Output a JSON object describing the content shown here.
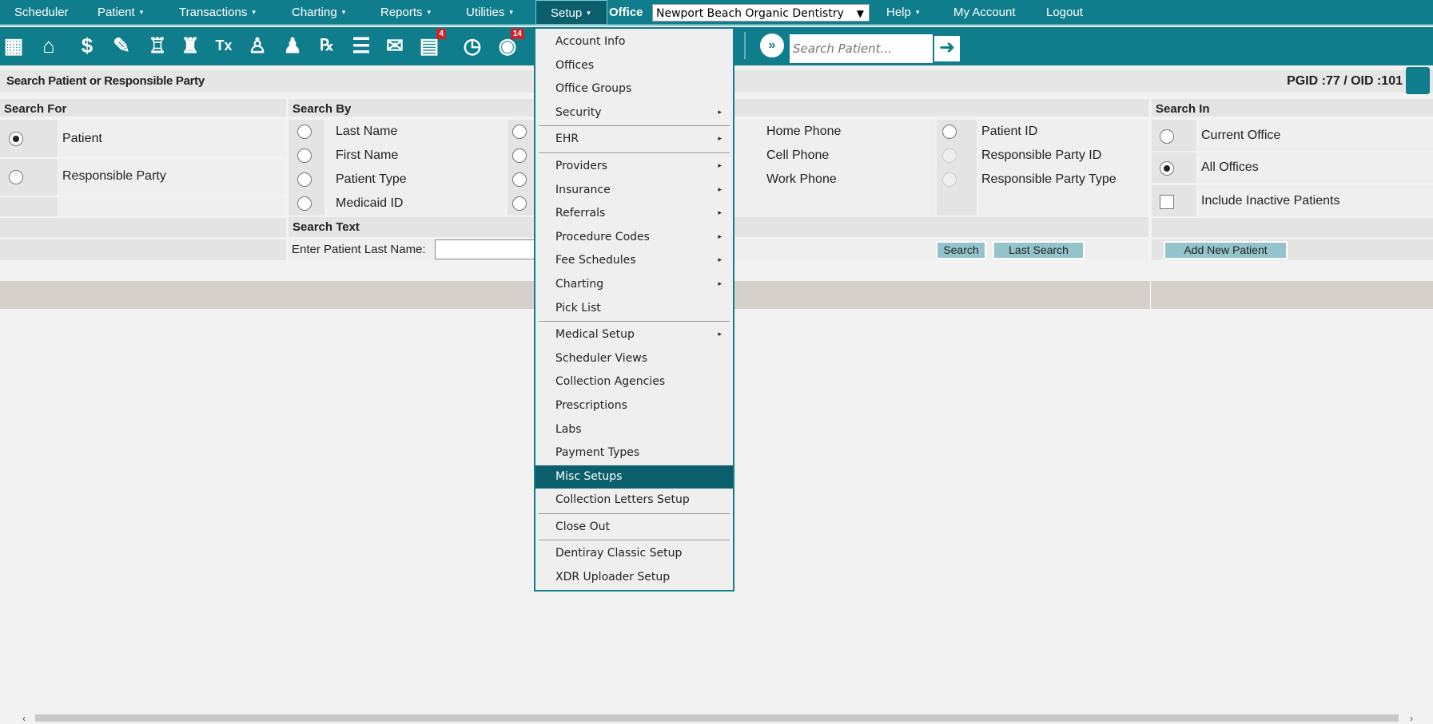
{
  "nav": {
    "items": [
      {
        "label": "Scheduler",
        "caret": false
      },
      {
        "label": "Patient",
        "caret": true
      },
      {
        "label": "Transactions",
        "caret": true
      },
      {
        "label": "Charting",
        "caret": true
      },
      {
        "label": "Reports",
        "caret": true
      },
      {
        "label": "Utilities",
        "caret": true
      },
      {
        "label": "Setup",
        "caret": true
      },
      {
        "label": "Help",
        "caret": true
      },
      {
        "label": "My Account",
        "caret": false
      },
      {
        "label": "Logout",
        "caret": false
      }
    ],
    "office_label": "Office",
    "office_value": "Newport Beach Organic Dentistry",
    "caret": "▾",
    "dropdown": "▼"
  },
  "toolbar": {
    "icons": [
      "calendar-icon",
      "home-icon",
      "billing-icon",
      "notes-icon",
      "tooth-icon",
      "crown-icon",
      "treatment-icon",
      "add-patient-icon",
      "add-family-icon",
      "prescription-icon",
      "notepad-icon",
      "mail-icon",
      "messages-icon",
      "clock-icon",
      "contacts-icon"
    ],
    "messages_badge": "4",
    "contacts_badge": "14",
    "search_placeholder": "Search Patient..."
  },
  "header": {
    "title": "Search Patient or Responsible Party",
    "ids": "PGID :77  /  OID :101"
  },
  "search_for": {
    "title": "Search For",
    "options": [
      {
        "label": "Patient",
        "selected": true
      },
      {
        "label": "Responsible Party",
        "selected": false
      }
    ]
  },
  "search_by": {
    "title": "Search By",
    "col1": [
      "Last Name",
      "First Name",
      "Patient Type",
      "Medicaid ID"
    ],
    "col3": [
      "Home Phone",
      "Cell Phone",
      "Work Phone"
    ],
    "col4": [
      "Patient ID",
      "Responsible Party ID",
      "Responsible Party Type"
    ]
  },
  "search_text": {
    "title": "Search Text",
    "label": "Enter Patient Last Name:",
    "value": "",
    "search_button": "Search",
    "last_search_button": "Last Search"
  },
  "search_in": {
    "title": "Search In",
    "options": [
      {
        "label": "Current Office",
        "selected": false
      },
      {
        "label": "All Offices",
        "selected": true
      }
    ],
    "inactive_label": "Include Inactive Patients",
    "inactive_checked": false,
    "add_button": "Add New Patient"
  },
  "setup_menu": {
    "items": [
      "Account Info",
      "Offices",
      "Office Groups",
      "Security",
      "EHR",
      "Providers",
      "Insurance",
      "Referrals",
      "Procedure Codes",
      "Fee Schedules",
      "Charting",
      "Pick List",
      "Medical Setup",
      "Scheduler Views",
      "Collection Agencies",
      "Prescriptions",
      "Labs",
      "Payment Types",
      "Misc Setups",
      "Collection Letters Setup",
      "Close Out",
      "Dentiray Classic Setup",
      "XDR Uploader Setup"
    ],
    "submenu_arrow": "▸",
    "highlighted": "Misc Setups"
  },
  "colors": {
    "brand": "#0f7d8c",
    "highlight": "#0b5f6c",
    "button": "#95c3cb",
    "badge": "#d0202a"
  }
}
